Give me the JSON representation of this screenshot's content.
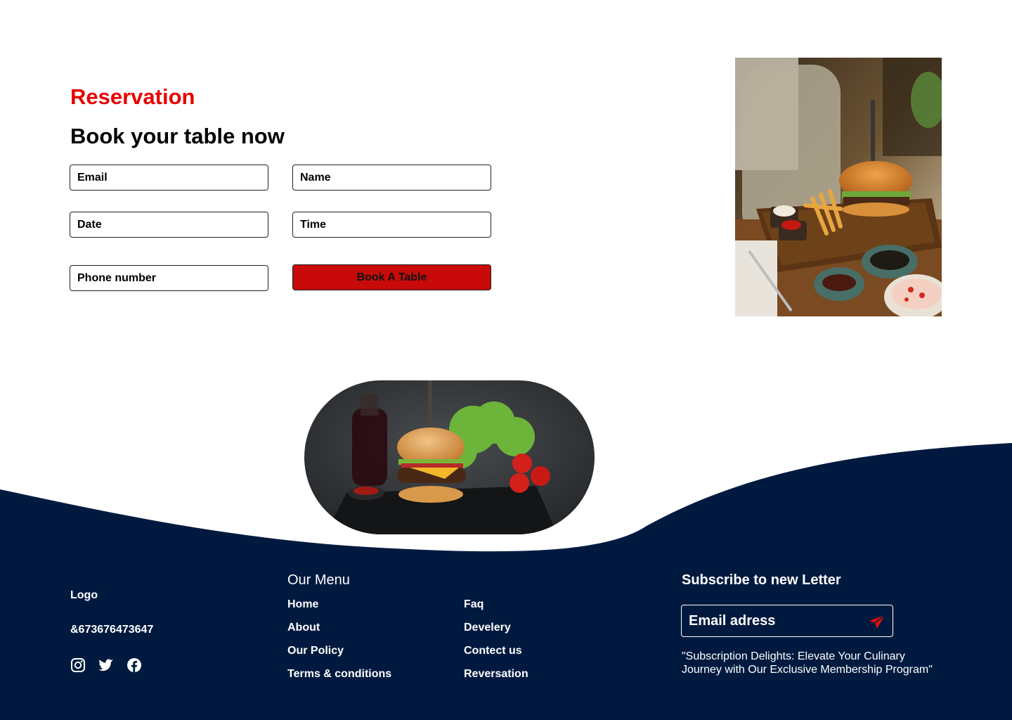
{
  "reservation": {
    "eyebrow": "Reservation",
    "headline": "Book your table now",
    "fields": {
      "email": "Email",
      "name": "Name",
      "date": "Date",
      "time": "Time",
      "phone": "Phone number"
    },
    "submit_label": "Book A Table"
  },
  "footer": {
    "logo": "Logo",
    "phone": "&673676473647",
    "social": [
      "instagram-icon",
      "twitter-icon",
      "facebook-icon"
    ],
    "menu_title": "Our Menu",
    "menu_col1": [
      "Home",
      "About",
      "Our Policy",
      "Terms & conditions"
    ],
    "menu_col2": [
      "Faq",
      "Develery",
      "Contect us",
      "Reversation"
    ],
    "subscribe_title": "Subscribe to new Letter",
    "subscribe_placeholder": "Email adress",
    "subscribe_quote": "\"Subscription Delights: Elevate Your Culinary Journey with Our Exclusive Membership Program\""
  },
  "colors": {
    "accent": "#e60000",
    "button": "#c80a0a",
    "footer_bg": "#001a3f"
  }
}
